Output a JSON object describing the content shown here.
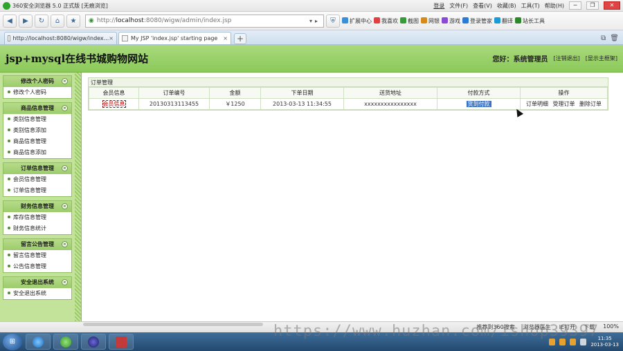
{
  "window": {
    "title": "360安全浏览器 5.0 正式版 [无痕浏览]",
    "login": "登录",
    "menu": [
      "文件(F)",
      "查看(V)",
      "收藏(B)",
      "工具(T)",
      "帮助(H)"
    ]
  },
  "toolbar": {
    "address_prefix": "http://",
    "address_host": "localhost",
    "address_rest": ":8080/wigw/admin/index.jsp",
    "tools": [
      "扩展中心",
      "我喜欢",
      "截图",
      "网银",
      "游戏",
      "登录管家",
      "翻译",
      "站长工具"
    ]
  },
  "tabs": [
    {
      "label": "http://localhost:8080/wigw/index..."
    },
    {
      "label": "My JSP 'index.jsp' starting page"
    }
  ],
  "header": {
    "site_title": "jsp+mysql在线书城购物网站",
    "greeting": "您好：系统管理员",
    "links": [
      "[注销退出]",
      "[显示主框架]"
    ]
  },
  "sidebar": {
    "groups": [
      {
        "title": "修改个人密码",
        "items": [
          "修改个人密码"
        ]
      },
      {
        "title": "商品信息管理",
        "items": [
          "类别信息管理",
          "类别信息添加",
          "商品信息管理",
          "商品信息添加"
        ]
      },
      {
        "title": "订单信息管理",
        "items": [
          "会员信息管理",
          "订单信息管理"
        ]
      },
      {
        "title": "财务信息管理",
        "items": [
          "库存信息管理",
          "财务信息统计"
        ]
      },
      {
        "title": "留言公告管理",
        "items": [
          "留言信息管理",
          "公告信息管理"
        ]
      },
      {
        "title": "安全退出系统",
        "items": [
          "安全退出系统"
        ]
      }
    ]
  },
  "main": {
    "panel_title": "订单管理",
    "columns": [
      "会员信息",
      "订单编号",
      "金额",
      "下单日期",
      "送货地址",
      "付款方式",
      "操作"
    ],
    "rows": [
      {
        "member": "会员信息",
        "order_no": "20130313113455",
        "amount": "￥1250",
        "date": "2013-03-13 11:34:55",
        "address": "xxxxxxxxxxxxxxxx",
        "payment": "货到付款",
        "actions": [
          "订单明细",
          "受理订单",
          "删除订单"
        ]
      }
    ]
  },
  "statusbar": {
    "items": [
      "推荐到360搜索",
      "浏览器医生",
      "IE打开",
      "下载",
      "100%"
    ]
  },
  "taskbar": {
    "time": "11:35",
    "date": "2013-03-13"
  },
  "watermark": "https://www.huzhan.com/ishop39397",
  "colors": {
    "header_green": "#8bc95a",
    "sidebar_green": "#c3e39b",
    "link_red": "#b00000"
  }
}
